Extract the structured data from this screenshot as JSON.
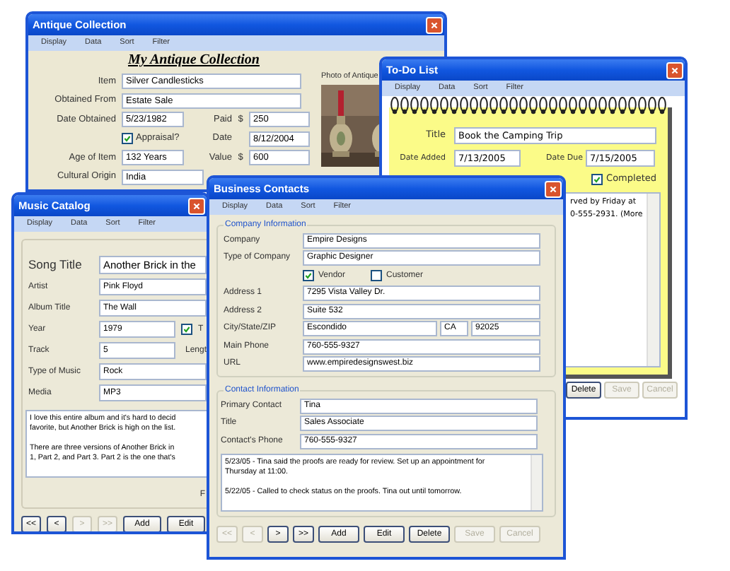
{
  "antique_window": {
    "title": "Antique Collection",
    "menu": [
      "Display",
      "Data",
      "Sort",
      "Filter"
    ],
    "heading": "My Antique Collection",
    "item": {
      "label": "Item",
      "value": "Silver Candlesticks"
    },
    "obtained_from": {
      "label": "Obtained From",
      "value": "Estate Sale"
    },
    "date_obtained": {
      "label": "Date Obtained",
      "value": "5/23/1982"
    },
    "paid": {
      "label": "Paid",
      "prefix": "$",
      "value": "250"
    },
    "appraisal": {
      "label": "Appraisal?",
      "checked": true
    },
    "appraisal_date": {
      "label": "Date",
      "value": "8/12/2004"
    },
    "age": {
      "label": "Age of Item",
      "value": "132 Years"
    },
    "item_value": {
      "label": "Value",
      "prefix": "$",
      "value": "600"
    },
    "cultural_origin": {
      "label": "Cultural Origin",
      "value": "India"
    },
    "photo_label": "Photo of Antique"
  },
  "todo_window": {
    "title": "To-Do List",
    "menu": [
      "Display",
      "Data",
      "Sort",
      "Filter"
    ],
    "title_field": {
      "label": "Title",
      "value": "Book the Camping Trip"
    },
    "date_added": {
      "label": "Date Added",
      "value": "7/13/2005"
    },
    "date_due": {
      "label": "Date Due",
      "value": "7/15/2005"
    },
    "completed": {
      "label": "Completed",
      "checked": true
    },
    "notes": "rved by Friday at\n0-555-2931. (More",
    "buttons": [
      {
        "label": "Delete",
        "disabled": false
      },
      {
        "label": "Save",
        "disabled": true
      },
      {
        "label": "Cancel",
        "disabled": true
      }
    ]
  },
  "music_window": {
    "title": "Music Catalog",
    "menu": [
      "Display",
      "Data",
      "Sort",
      "Filter"
    ],
    "song_title": {
      "label": "Song Title",
      "value": "Another Brick in the"
    },
    "artist": {
      "label": "Artist",
      "value": "Pink Floyd"
    },
    "album_title": {
      "label": "Album Title",
      "value": "The Wall"
    },
    "year": {
      "label": "Year",
      "value": "1979"
    },
    "year_checkbox": {
      "label": "T",
      "checked": true
    },
    "track": {
      "label": "Track",
      "value": "5"
    },
    "length_label": "Lengt",
    "type_of_music": {
      "label": "Type of Music",
      "value": "Rock"
    },
    "media": {
      "label": "Media",
      "value": "MP3"
    },
    "notes": [
      "I love this entire album and it's hard to decid\nfavorite, but Another Brick is high on the list.",
      "There are three versions of Another Brick in\n1, Part 2, and Part 3. Part 2 is the one that's"
    ],
    "footer_label": "F",
    "buttons": [
      {
        "label": "<<",
        "kind": "nav",
        "disabled": false
      },
      {
        "label": "<",
        "kind": "nav",
        "disabled": false
      },
      {
        "label": ">",
        "kind": "nav",
        "disabled": true
      },
      {
        "label": ">>",
        "kind": "nav",
        "disabled": true
      },
      {
        "label": "Add",
        "kind": "action",
        "disabled": false
      },
      {
        "label": "Edit",
        "kind": "action",
        "disabled": false
      }
    ]
  },
  "contacts_window": {
    "title": "Business Contacts",
    "menu": [
      "Display",
      "Data",
      "Sort",
      "Filter"
    ],
    "company_group": "Company Information",
    "company": {
      "label": "Company",
      "value": "Empire Designs"
    },
    "type_of_company": {
      "label": "Type of Company",
      "value": "Graphic Designer"
    },
    "vendor": {
      "label": "Vendor",
      "checked": true
    },
    "customer": {
      "label": "Customer",
      "checked": false
    },
    "address_1": {
      "label": "Address 1",
      "value": "7295 Vista Valley Dr."
    },
    "address_2": {
      "label": "Address 2",
      "value": "Suite 532"
    },
    "city_state_zip": {
      "label": "City/State/ZIP",
      "city": "Escondido",
      "state": "CA",
      "zip": "92025"
    },
    "main_phone": {
      "label": "Main Phone",
      "value": "760-555-9327"
    },
    "url": {
      "label": "URL",
      "value": "www.empiredesignswest.biz"
    },
    "contact_group": "Contact Information",
    "primary_contact": {
      "label": "Primary Contact",
      "value": "Tina"
    },
    "contact_title": {
      "label": "Title",
      "value": "Sales Associate"
    },
    "contact_phone": {
      "label": "Contact's Phone",
      "value": "760-555-9327"
    },
    "notes": [
      "5/23/05 - Tina said the proofs are ready for review. Set up an appointment for\nThursday at 11:00.",
      "5/22/05 - Called to check status on the proofs. Tina out until tomorrow."
    ],
    "buttons": [
      {
        "label": "<<",
        "kind": "nav",
        "disabled": true
      },
      {
        "label": "<",
        "kind": "nav",
        "disabled": true
      },
      {
        "label": ">",
        "kind": "nav",
        "disabled": false
      },
      {
        "label": ">>",
        "kind": "nav",
        "disabled": false
      },
      {
        "label": "Add",
        "kind": "action",
        "disabled": false
      },
      {
        "label": "Edit",
        "kind": "action",
        "disabled": false
      },
      {
        "label": "Delete",
        "kind": "action",
        "disabled": false
      },
      {
        "label": "Save",
        "kind": "action",
        "disabled": true
      },
      {
        "label": "Cancel",
        "kind": "action",
        "disabled": true
      }
    ]
  }
}
